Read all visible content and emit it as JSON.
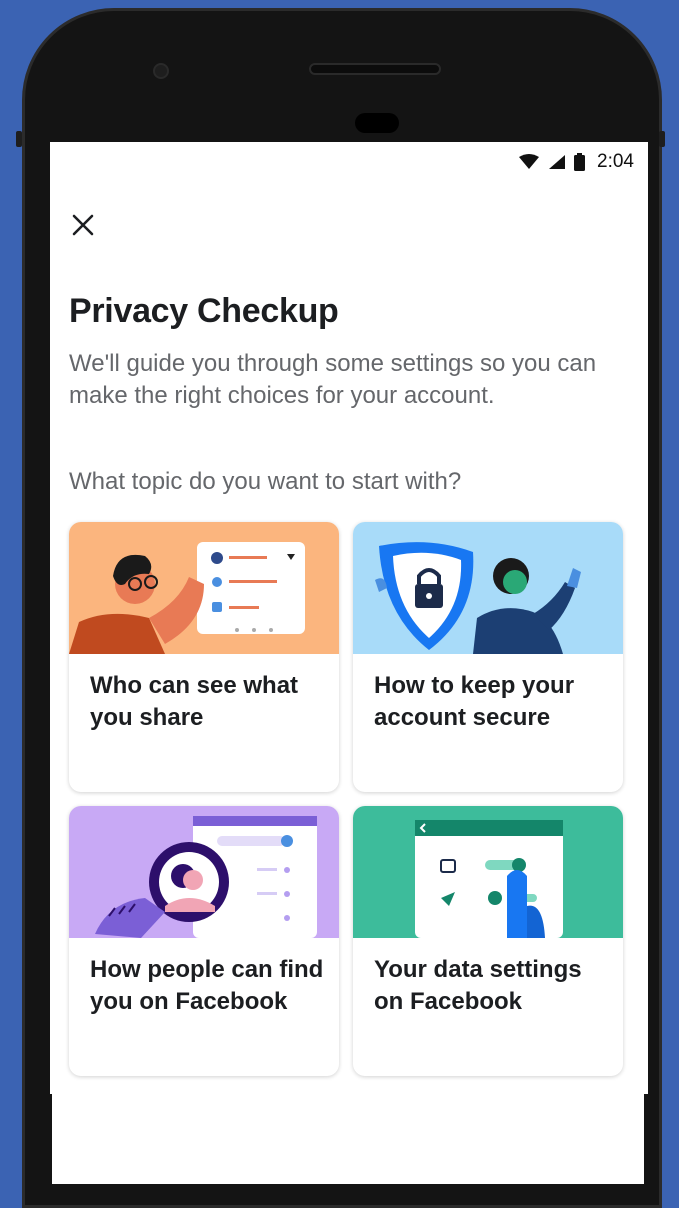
{
  "status_bar": {
    "time": "2:04",
    "icons": [
      "wifi-icon",
      "signal-icon",
      "battery-icon"
    ]
  },
  "close_icon": "close-icon",
  "title": "Privacy Checkup",
  "description": "We'll guide you through some settings so you can make the right choices for your account.",
  "prompt": "What topic do you want to start with?",
  "topics": [
    {
      "label": "Who can see what you share",
      "illustration": "person-audience-illustration",
      "color": "#fbb57e"
    },
    {
      "label": "How to keep your account secure",
      "illustration": "shield-lock-illustration",
      "color": "#a8dbf9"
    },
    {
      "label": "How people can find you on Facebook",
      "illustration": "magnifier-search-illustration",
      "color": "#c8a9f5"
    },
    {
      "label": "Your data settings on Facebook",
      "illustration": "data-settings-illustration",
      "color": "#3dbc9b"
    }
  ],
  "colors": {
    "background": "#3b63b3",
    "title_text": "#1c1e21",
    "secondary_text": "#65676b"
  }
}
